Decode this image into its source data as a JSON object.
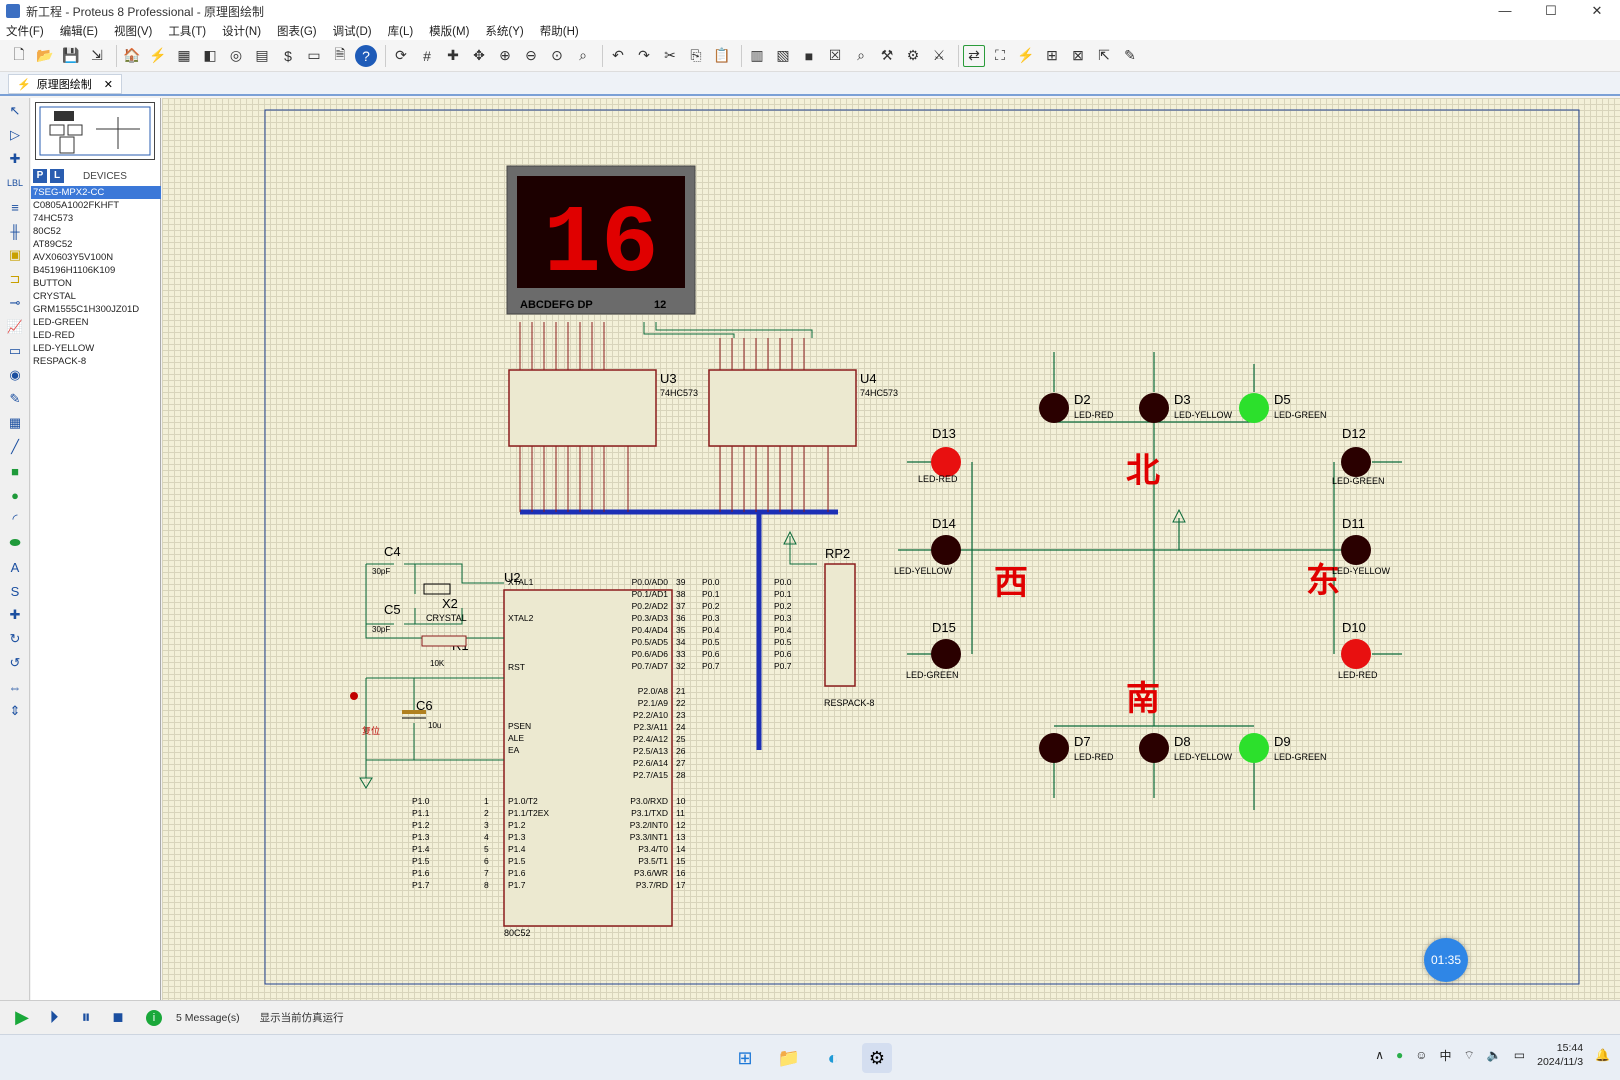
{
  "window": {
    "title": "新工程 - Proteus 8 Professional - 原理图绘制",
    "min": "—",
    "max": "☐",
    "close": "✕"
  },
  "menu": [
    "文件(F)",
    "编辑(E)",
    "视图(V)",
    "工具(T)",
    "设计(N)",
    "图表(G)",
    "调试(D)",
    "库(L)",
    "模版(M)",
    "系统(Y)",
    "帮助(H)"
  ],
  "tab": {
    "label": "原理图绘制",
    "close": "✕"
  },
  "devices": {
    "P": "P",
    "L": "L",
    "header": "DEVICES",
    "items": [
      "7SEG-MPX2-CC",
      "C0805A1002FKHFT",
      "74HC573",
      "80C52",
      "AT89C52",
      "AVX0603Y5V100N",
      "B45196H1106K109",
      "BUTTON",
      "CRYSTAL",
      "GRM1555C1H300JZ01D",
      "LED-GREEN",
      "LED-RED",
      "LED-YELLOW",
      "RESPACK-8"
    ],
    "selected_index": 0
  },
  "schematic": {
    "display": {
      "digits": "16",
      "label_left": "ABCDEFG  DP",
      "label_right": "12"
    },
    "u3": {
      "ref": "U3",
      "part": "74HC573"
    },
    "u4": {
      "ref": "U4",
      "part": "74HC573"
    },
    "u2": {
      "ref": "U2",
      "part": "80C52"
    },
    "rp2": {
      "ref": "RP2",
      "part": "RESPACK-8"
    },
    "c4": {
      "ref": "C4",
      "val": "30pF"
    },
    "c5": {
      "ref": "C5",
      "val": "30pF"
    },
    "c6": {
      "ref": "C6",
      "val": "10u"
    },
    "x2": {
      "ref": "X2",
      "part": "CRYSTAL"
    },
    "r1": {
      "ref": "R1",
      "val": "10K"
    },
    "button": "复位",
    "directions": {
      "north": "北",
      "south": "南",
      "east": "东",
      "west": "西"
    },
    "leds": {
      "D2": "LED-RED",
      "D3": "LED-YELLOW",
      "D5": "LED-GREEN",
      "D13": "LED-RED",
      "D14": "LED-YELLOW",
      "D15": "LED-GREEN",
      "D12": "LED-GREEN",
      "D11": "LED-YELLOW",
      "D10": "LED-RED",
      "D7": "LED-RED",
      "D8": "LED-YELLOW",
      "D9": "LED-GREEN"
    },
    "u2_left_pins": [
      "XTAL1",
      "XTAL2",
      "RST",
      "PSEN",
      "ALE",
      "EA",
      "P1.0/T2",
      "P1.1/T2EX",
      "P1.2",
      "P1.3",
      "P1.4",
      "P1.5",
      "P1.6",
      "P1.7"
    ],
    "u2_right_pins": [
      "P0.0/AD0",
      "P0.1/AD1",
      "P0.2/AD2",
      "P0.3/AD3",
      "P0.4/AD4",
      "P0.5/AD5",
      "P0.6/AD6",
      "P0.7/AD7",
      "P2.0/A8",
      "P2.1/A9",
      "P2.2/A10",
      "P2.3/A11",
      "P2.4/A12",
      "P2.5/A13",
      "P2.6/A14",
      "P2.7/A15",
      "P3.0/RXD",
      "P3.1/TXD",
      "P3.2/INT0",
      "P3.3/INT1",
      "P3.4/T0",
      "P3.5/T1",
      "P3.6/WR",
      "P3.7/RD"
    ],
    "u2_right_nums": [
      "39",
      "38",
      "37",
      "36",
      "35",
      "34",
      "33",
      "32",
      "21",
      "22",
      "23",
      "24",
      "25",
      "26",
      "27",
      "28",
      "10",
      "11",
      "12",
      "13",
      "14",
      "15",
      "16",
      "17"
    ],
    "p0_labels": [
      "P0.0",
      "P0.1",
      "P0.2",
      "P0.3",
      "P0.4",
      "P0.5",
      "P0.6",
      "P0.7"
    ],
    "p1_labels": [
      "P1.0",
      "P1.1",
      "P1.2",
      "P1.3",
      "P1.4",
      "P1.5",
      "P1.6",
      "P1.7"
    ],
    "p1_nums": [
      "1",
      "2",
      "3",
      "4",
      "5",
      "6",
      "7",
      "8"
    ]
  },
  "status": {
    "messages": "5 Message(s)",
    "text": "显示当前仿真运行"
  },
  "timer": "01:35",
  "taskbar": {
    "time": "15:44",
    "date": "2024/11/3",
    "ime": "中"
  }
}
